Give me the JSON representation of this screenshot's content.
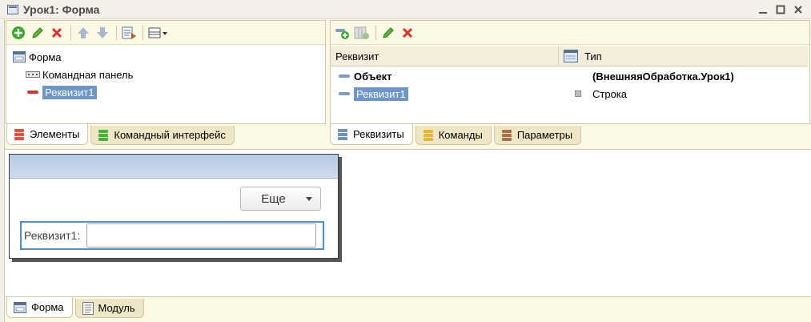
{
  "window": {
    "title": "Урок1: Форма"
  },
  "elements_panel": {
    "tree": [
      {
        "label": "Форма",
        "icon": "form-icon"
      },
      {
        "label": "Командная панель",
        "icon": "command-bar-icon"
      },
      {
        "label": "Реквизит1",
        "icon": "field-icon",
        "selected": true
      }
    ],
    "tabs": [
      {
        "label": "Элементы",
        "active": true
      },
      {
        "label": "Командный интерфейс",
        "active": false
      }
    ]
  },
  "attributes_panel": {
    "columns": {
      "attribute": "Реквизит",
      "type": "Тип"
    },
    "rows": [
      {
        "name": "Объект",
        "type": "(ВнешняяОбработка.Урок1)",
        "bold": true
      },
      {
        "name": "Реквизит1",
        "type": "Строка",
        "selected": true
      }
    ],
    "tabs": [
      {
        "label": "Реквизиты",
        "active": true
      },
      {
        "label": "Команды",
        "active": false
      },
      {
        "label": "Параметры",
        "active": false
      }
    ]
  },
  "preview": {
    "more_button": "Еще",
    "field_label": "Реквизит1:",
    "field_value": ""
  },
  "bottom_tabs": [
    {
      "label": "Форма",
      "active": true
    },
    {
      "label": "Модуль",
      "active": false
    }
  ],
  "colors": {
    "panel_bg": "#fbf8e4",
    "selection": "#6c95c8",
    "focus_border": "#4a90d6",
    "add_green": "#3aa832",
    "delete_red": "#d9342b"
  }
}
